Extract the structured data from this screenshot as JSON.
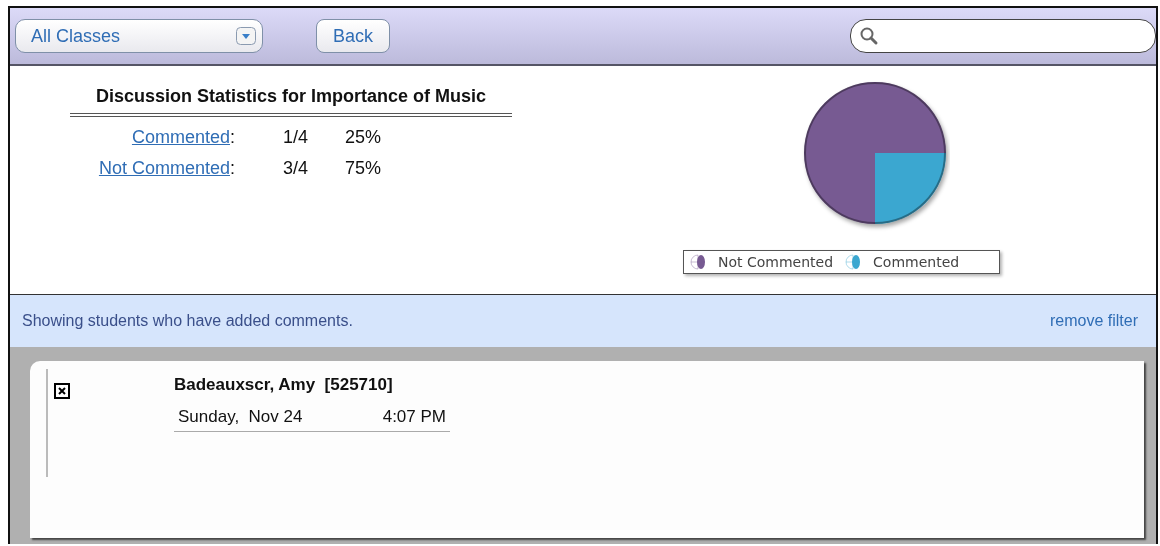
{
  "toolbar": {
    "class_select": {
      "value": "All Classes"
    },
    "back_button": "Back"
  },
  "statistics": {
    "title": "Discussion Statistics for Importance of Music",
    "rows": [
      {
        "label": "Commented",
        "separator": ":",
        "fraction": "1/4",
        "percent": "25%"
      },
      {
        "label": "Not Commented",
        "separator": ":",
        "fraction": "3/4",
        "percent": "75%"
      }
    ],
    "chart_data": {
      "type": "pie",
      "categories": [
        "Not Commented",
        "Commented"
      ],
      "values": [
        75,
        25
      ],
      "colors": [
        "#775a92",
        "#3ba7d0"
      ]
    }
  },
  "filter_bar": {
    "message": "Showing students who have added comments.",
    "link": "remove filter"
  },
  "comments": [
    {
      "student": "Badeauxscr, Amy  [525710]",
      "day": "Sunday,  Nov 24",
      "time": "4:07 PM"
    }
  ]
}
